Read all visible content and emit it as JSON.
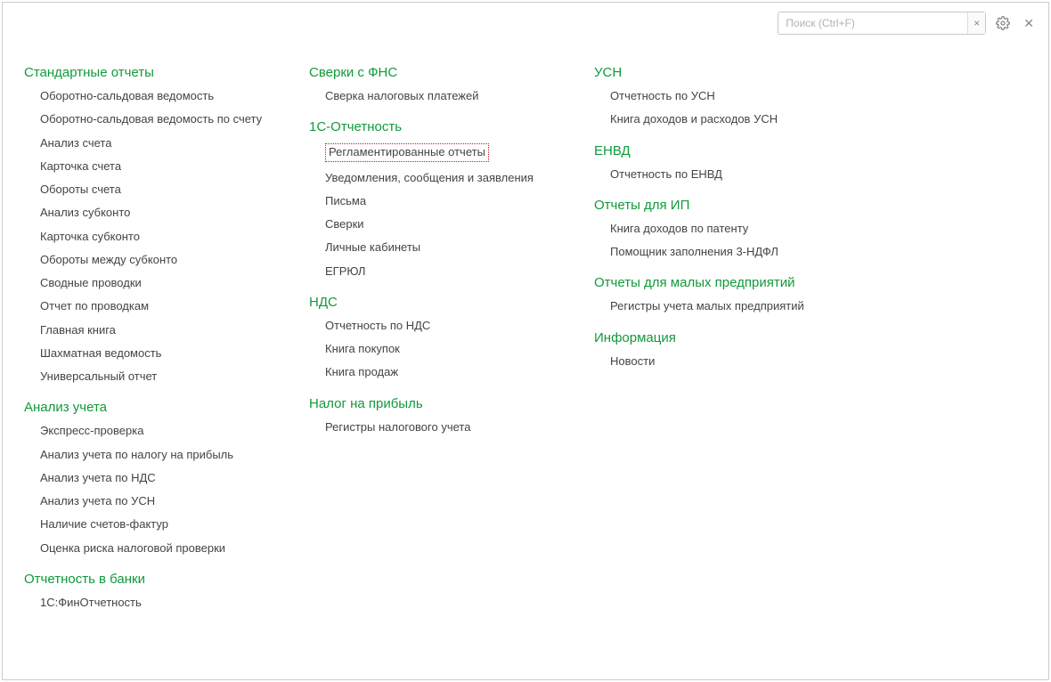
{
  "toolbar": {
    "search_placeholder": "Поиск (Ctrl+F)",
    "clear_label": "×"
  },
  "columns": [
    {
      "sections": [
        {
          "title": "Стандартные отчеты",
          "items": [
            "Оборотно-сальдовая ведомость",
            "Оборотно-сальдовая ведомость по счету",
            "Анализ счета",
            "Карточка счета",
            "Обороты счета",
            "Анализ субконто",
            "Карточка субконто",
            "Обороты между субконто",
            "Сводные проводки",
            "Отчет по проводкам",
            "Главная книга",
            "Шахматная ведомость",
            "Универсальный отчет"
          ]
        },
        {
          "title": "Анализ учета",
          "items": [
            "Экспресс-проверка",
            "Анализ учета по налогу на прибыль",
            "Анализ учета по НДС",
            "Анализ учета по УСН",
            "Наличие счетов-фактур",
            "Оценка риска налоговой проверки"
          ]
        },
        {
          "title": "Отчетность в банки",
          "items": [
            "1С:ФинОтчетность"
          ]
        }
      ]
    },
    {
      "sections": [
        {
          "title": "Сверки с ФНС",
          "items": [
            "Сверка налоговых платежей"
          ]
        },
        {
          "title": "1С-Отчетность",
          "items": [
            "Регламентированные отчеты",
            "Уведомления, сообщения и заявления",
            "Письма",
            "Сверки",
            "Личные кабинеты",
            "ЕГРЮЛ"
          ],
          "selected_index": 0
        },
        {
          "title": "НДС",
          "items": [
            "Отчетность по НДС",
            "Книга покупок",
            "Книга продаж"
          ]
        },
        {
          "title": "Налог на прибыль",
          "items": [
            "Регистры налогового учета"
          ]
        }
      ]
    },
    {
      "sections": [
        {
          "title": "УСН",
          "items": [
            "Отчетность по УСН",
            "Книга доходов и расходов УСН"
          ]
        },
        {
          "title": "ЕНВД",
          "items": [
            "Отчетность по ЕНВД"
          ]
        },
        {
          "title": "Отчеты для ИП",
          "items": [
            "Книга доходов по патенту",
            "Помощник заполнения 3-НДФЛ"
          ]
        },
        {
          "title": "Отчеты для малых предприятий",
          "items": [
            "Регистры учета малых предприятий"
          ]
        },
        {
          "title": "Информация",
          "items": [
            "Новости"
          ]
        }
      ]
    }
  ]
}
